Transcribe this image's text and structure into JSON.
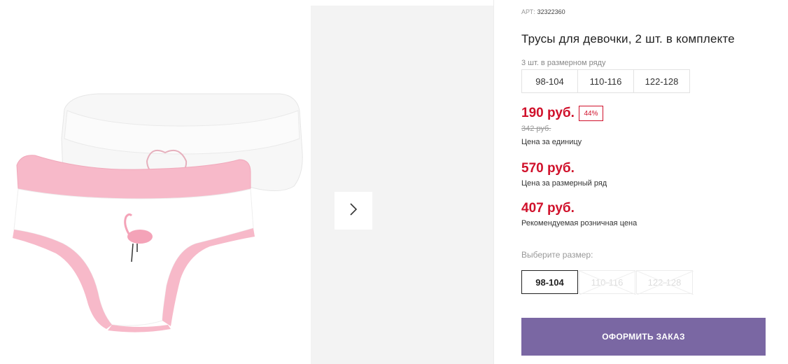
{
  "gallery": {
    "image_alt": "product-photo"
  },
  "product": {
    "sku_label": "АРТ:",
    "sku_value": "32322360",
    "title": "Трусы для девочки, 2 шт. в комплекте"
  },
  "size_row": {
    "label": "3 шт. в размерном ряду",
    "sizes": [
      "98-104",
      "110-116",
      "122-128"
    ]
  },
  "pricing": {
    "unit_price": "190 руб.",
    "discount": "44%",
    "old_price": "342 руб.",
    "unit_label": "Цена за единицу",
    "row_price": "570 руб.",
    "row_label": "Цена за размерный ряд",
    "rrp_price": "407 руб.",
    "rrp_label": "Рекомендуемая розничная цена"
  },
  "size_select": {
    "label": "Выберите размер:",
    "options": [
      "98-104",
      "110-116",
      "122-128"
    ],
    "selected": "98-104"
  },
  "actions": {
    "order_label": "ОФОРМИТЬ ЗАКАЗ"
  },
  "colors": {
    "accent_red": "#d0112b",
    "button_purple": "#7a67a3"
  }
}
